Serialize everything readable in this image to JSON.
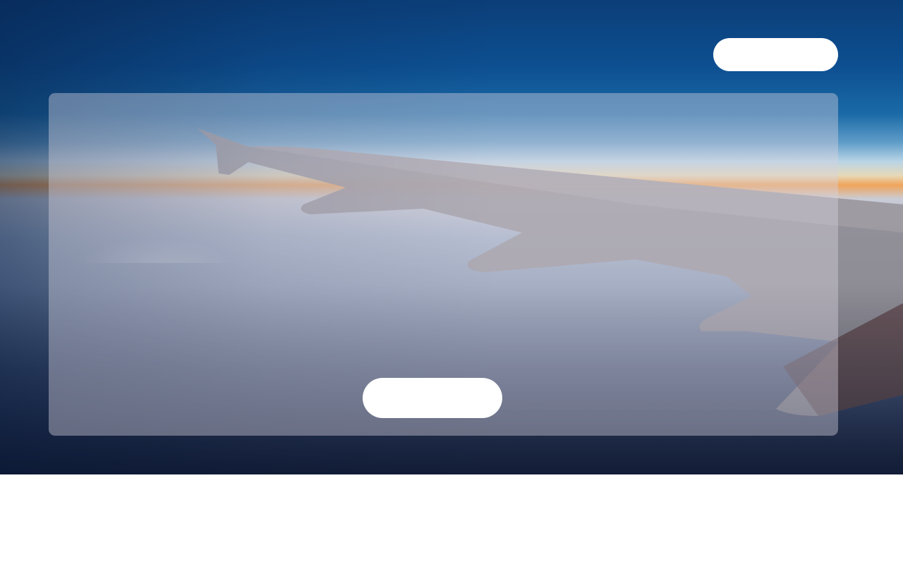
{
  "hero": {
    "image": "airplane-wing-above-clouds"
  },
  "header": {
    "top_button_label": ""
  },
  "card": {
    "center_button_label": ""
  },
  "colors": {
    "sky_top": "#0b3e78",
    "horizon_glow": "#f0a45a",
    "wing": "#8f8c93",
    "card_overlay": "#d7d2de",
    "button": "#ffffff",
    "footer": "#ffffff"
  }
}
